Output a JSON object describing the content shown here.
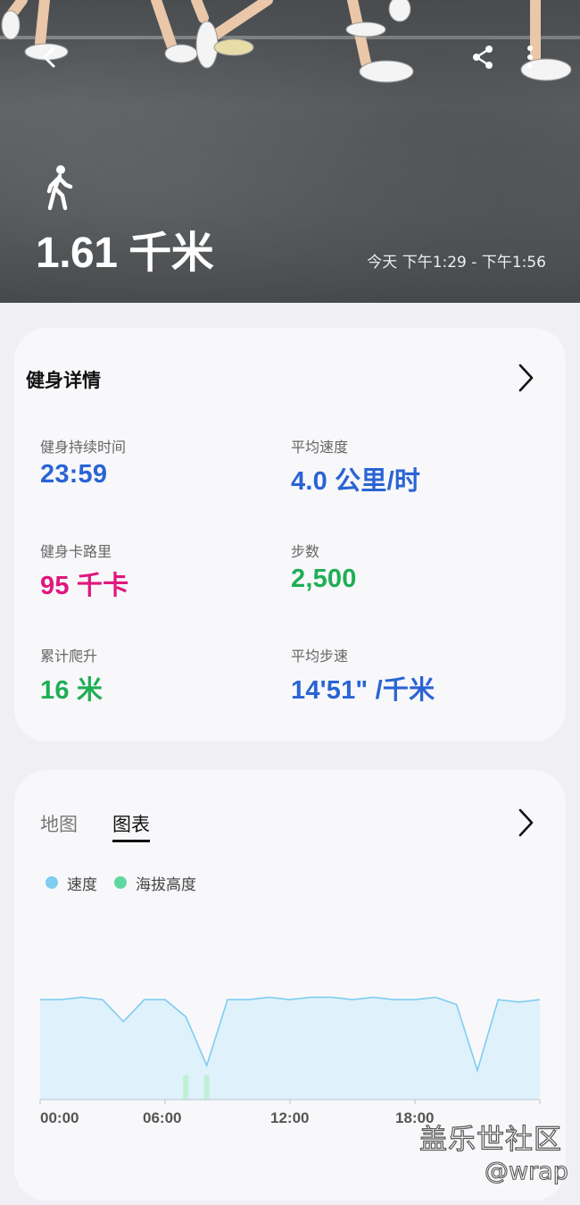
{
  "header": {
    "distance": "1.61 千米",
    "time_range": "今天 下午1:29 - 下午1:56",
    "activity_icon": "walking-person-icon"
  },
  "details": {
    "title": "健身详情",
    "metrics": {
      "duration": {
        "label": "健身持续时间",
        "value": "23:59",
        "color": "#2a64d4"
      },
      "avg_speed": {
        "label": "平均速度",
        "value": "4.0 公里/时",
        "color": "#2a64d4"
      },
      "calories": {
        "label": "健身卡路里",
        "value": "95 千卡",
        "color": "#e0177e"
      },
      "steps": {
        "label": "步数",
        "value": "2,500",
        "color": "#1fae55"
      },
      "climb": {
        "label": "累计爬升",
        "value": "16 米",
        "color": "#1fae55"
      },
      "avg_pace": {
        "label": "平均步速",
        "value": "14'51\" /千米",
        "color": "#2a64d4"
      }
    }
  },
  "chart_section": {
    "tabs": [
      "地图",
      "图表"
    ],
    "active_tab": "图表",
    "legend": [
      {
        "label": "速度",
        "color": "#7fcdf0"
      },
      {
        "label": "海拔高度",
        "color": "#5fd8a0"
      }
    ],
    "x_ticks": [
      "00:00",
      "06:00",
      "12:00",
      "18:00"
    ]
  },
  "chart_data": {
    "type": "area",
    "x_unit": "minutes",
    "x": [
      0,
      1,
      2,
      3,
      4,
      5,
      6,
      7,
      8,
      9,
      10,
      11,
      12,
      13,
      14,
      15,
      16,
      17,
      18,
      19,
      20,
      21,
      22,
      23,
      24
    ],
    "series": [
      {
        "name": "速度",
        "values": [
          4.1,
          4.1,
          4.2,
          4.1,
          3.2,
          4.1,
          4.1,
          3.4,
          1.4,
          4.1,
          4.1,
          4.2,
          4.1,
          4.2,
          4.2,
          4.1,
          4.2,
          4.1,
          4.1,
          4.2,
          3.9,
          1.2,
          4.1,
          4.0,
          4.1
        ]
      },
      {
        "name": "海拔高度",
        "values": [
          0,
          0,
          0,
          0,
          0,
          0,
          0,
          0.4,
          0.4,
          0,
          0,
          0,
          0,
          0,
          0,
          0,
          0,
          0,
          0,
          0,
          0,
          0,
          0,
          0,
          0
        ]
      }
    ],
    "xlim": [
      0,
      24
    ],
    "grid": false
  },
  "watermark": {
    "line1": "盖乐世社区",
    "line2": "@wrap"
  }
}
